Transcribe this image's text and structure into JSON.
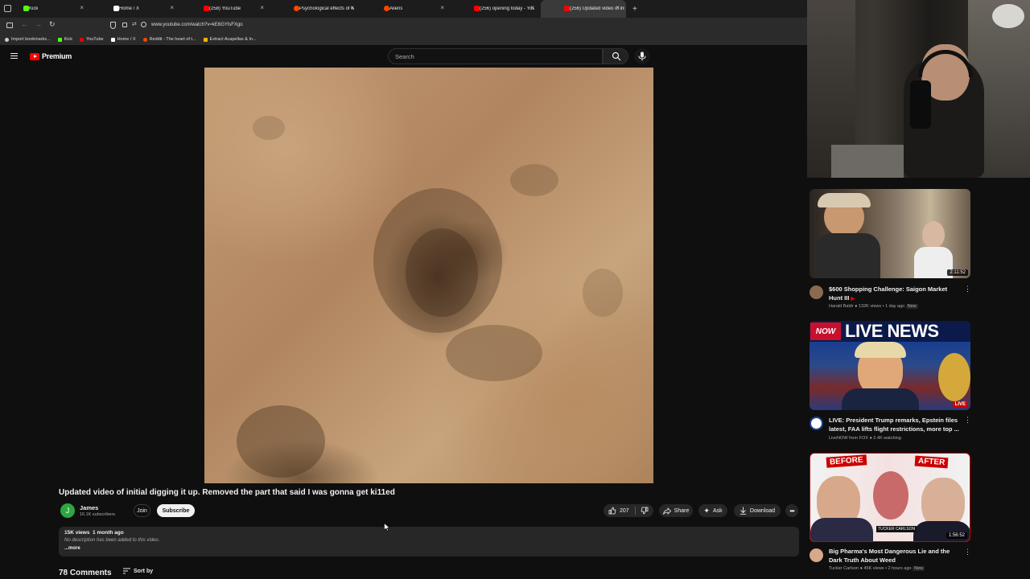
{
  "browser": {
    "tabs": [
      {
        "label": "Kick",
        "color": "#53fc18"
      },
      {
        "label": "Home / X",
        "color": "#ffffff"
      },
      {
        "label": "(258) YouTube",
        "color": "#ff0000"
      },
      {
        "label": "Psychological effects of watchi",
        "color": "#ff4500"
      },
      {
        "label": "Aliens",
        "color": "#ff4500"
      },
      {
        "label": "(256) opening today - YouTube",
        "color": "#ff0000"
      },
      {
        "label": "(256) Updated video of ini",
        "color": "#ff0000"
      }
    ],
    "url": "www.youtube.com/watch?v=kE6GYlsFXgo",
    "bookmarks": [
      "Import bookmarks...",
      "Kick",
      "YouTube",
      "Home / X",
      "Reddit - The heart of t...",
      "Extract Acapellas & In..."
    ]
  },
  "yt": {
    "brand": "Premium",
    "search_placeholder": "Search"
  },
  "video": {
    "title": "Updated video of initial digging it up. Removed the part that said I was gonna get ki11ed",
    "channel": "James",
    "subscribers": "16.1K subscribers",
    "join_label": "Join",
    "subscribe_label": "Subscribe",
    "likes": "207",
    "share_label": "Share",
    "ask_label": "Ask",
    "download_label": "Download",
    "views_date": "15K views  1 month ago",
    "description": "No description has been added to this video.",
    "more_label": "...more",
    "comments_count": "78 Comments",
    "sort_label": "Sort by"
  },
  "sidebar": [
    {
      "title": "$600 Shopping Challenge: Saigon Market Hunt III",
      "channel": "Harald Baldr",
      "meta": "132K views • 1 day ago",
      "badge": "New",
      "duration": "2:11:52"
    },
    {
      "title": "LIVE: President Trump remarks, Epstein files latest, FAA lifts flight restrictions, more top ...",
      "channel": "LiveNOW from FOX",
      "meta": "2.4K watching",
      "badge": "",
      "duration": "LIVE",
      "banner": "LIVE NEWS",
      "banner_small": "NOW"
    },
    {
      "title": "Big Pharma's Most Dangerous Lie and the Dark Truth About Weed",
      "channel": "Tucker Carlson",
      "meta": "45K views • 2 hours ago",
      "badge": "New",
      "duration": "1:56:52",
      "labels": [
        "BEFORE",
        "AFTER"
      ],
      "sublabel": "TUCKER CARLSON"
    }
  ],
  "icons": {
    "menu": "hamburger-icon",
    "search": "search-icon",
    "mic": "microphone-icon",
    "like": "thumbs-up-icon",
    "dislike": "thumbs-down-icon",
    "share": "share-icon",
    "ask": "sparkle-icon",
    "download": "download-icon",
    "more": "more-horizontal-icon",
    "sort": "sort-icon"
  }
}
